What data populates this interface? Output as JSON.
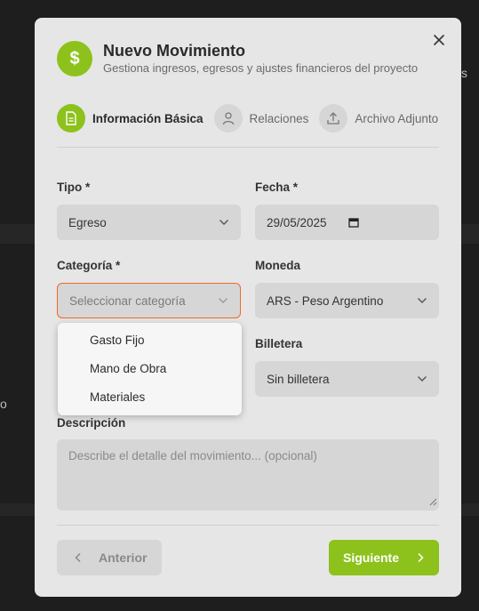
{
  "backdrop": {
    "right_text": "s",
    "left_text": "o"
  },
  "modal": {
    "title": "Nuevo Movimiento",
    "subtitle": "Gestiona ingresos, egresos y ajustes financieros del proyecto",
    "header_icon_glyph": "$",
    "close_icon": "close-icon"
  },
  "steps": [
    {
      "label": "Información Básica",
      "icon": "document-icon",
      "active": true
    },
    {
      "label": "Relaciones",
      "icon": "user-icon",
      "active": false
    },
    {
      "label": "Archivo Adjunto",
      "icon": "upload-icon",
      "active": false
    }
  ],
  "form": {
    "tipo": {
      "label": "Tipo *",
      "value": "Egreso"
    },
    "fecha": {
      "label": "Fecha *",
      "value": "29/05/2025"
    },
    "categoria": {
      "label": "Categoría *",
      "placeholder": "Seleccionar categoría"
    },
    "moneda": {
      "label": "Moneda",
      "value": "ARS - Peso Argentino"
    },
    "billetera": {
      "label": "Billetera",
      "value": "Sin billetera"
    },
    "descripcion": {
      "label": "Descripción",
      "placeholder": "Describe el detalle del movimiento... (opcional)"
    }
  },
  "categoria_options": [
    "Gasto Fijo",
    "Mano de Obra",
    "Materiales"
  ],
  "buttons": {
    "prev": "Anterior",
    "next": "Siguiente"
  },
  "colors": {
    "accent": "#8cc21b",
    "focus_border": "#ee6a2a",
    "modal_bg": "#e6e6e6",
    "field_bg": "#d6d6d6"
  }
}
